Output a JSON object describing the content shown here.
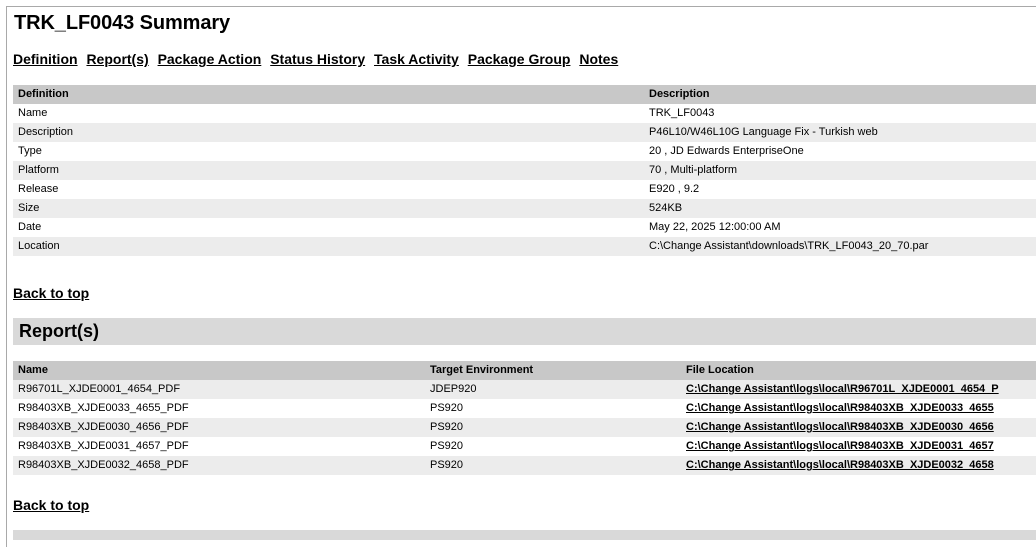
{
  "page": {
    "title": "TRK_LF0043 Summary",
    "nav": [
      "Definition",
      "Report(s)",
      "Package Action",
      "Status History",
      "Task Activity",
      "Package Group",
      "Notes"
    ],
    "back_to_top": "Back to top"
  },
  "definition": {
    "headers": [
      "Definition",
      "Description"
    ],
    "rows": [
      [
        "Name",
        "TRK_LF0043"
      ],
      [
        "Description",
        "P46L10/W46L10G Language Fix - Turkish web"
      ],
      [
        "Type",
        "20 , JD Edwards EnterpriseOne"
      ],
      [
        "Platform",
        "70 , Multi-platform"
      ],
      [
        "Release",
        "E920 , 9.2"
      ],
      [
        "Size",
        "524KB"
      ],
      [
        "Date",
        "May 22, 2025 12:00:00 AM"
      ],
      [
        "Location",
        "C:\\Change Assistant\\downloads\\TRK_LF0043_20_70.par"
      ]
    ]
  },
  "reports": {
    "section_title": "Report(s)",
    "headers": [
      "Name",
      "Target Environment",
      "File Location"
    ],
    "rows": [
      [
        "R96701L_XJDE0001_4654_PDF",
        "JDEP920",
        "C:\\Change Assistant\\logs\\local\\R96701L_XJDE0001_4654_P"
      ],
      [
        "R98403XB_XJDE0033_4655_PDF",
        "PS920",
        "C:\\Change Assistant\\logs\\local\\R98403XB_XJDE0033_4655"
      ],
      [
        "R98403XB_XJDE0030_4656_PDF",
        "PS920",
        "C:\\Change Assistant\\logs\\local\\R98403XB_XJDE0030_4656"
      ],
      [
        "R98403XB_XJDE0031_4657_PDF",
        "PS920",
        "C:\\Change Assistant\\logs\\local\\R98403XB_XJDE0031_4657"
      ],
      [
        "R98403XB_XJDE0032_4658_PDF",
        "PS920",
        "C:\\Change Assistant\\logs\\local\\R98403XB_XJDE0032_4658"
      ]
    ]
  }
}
